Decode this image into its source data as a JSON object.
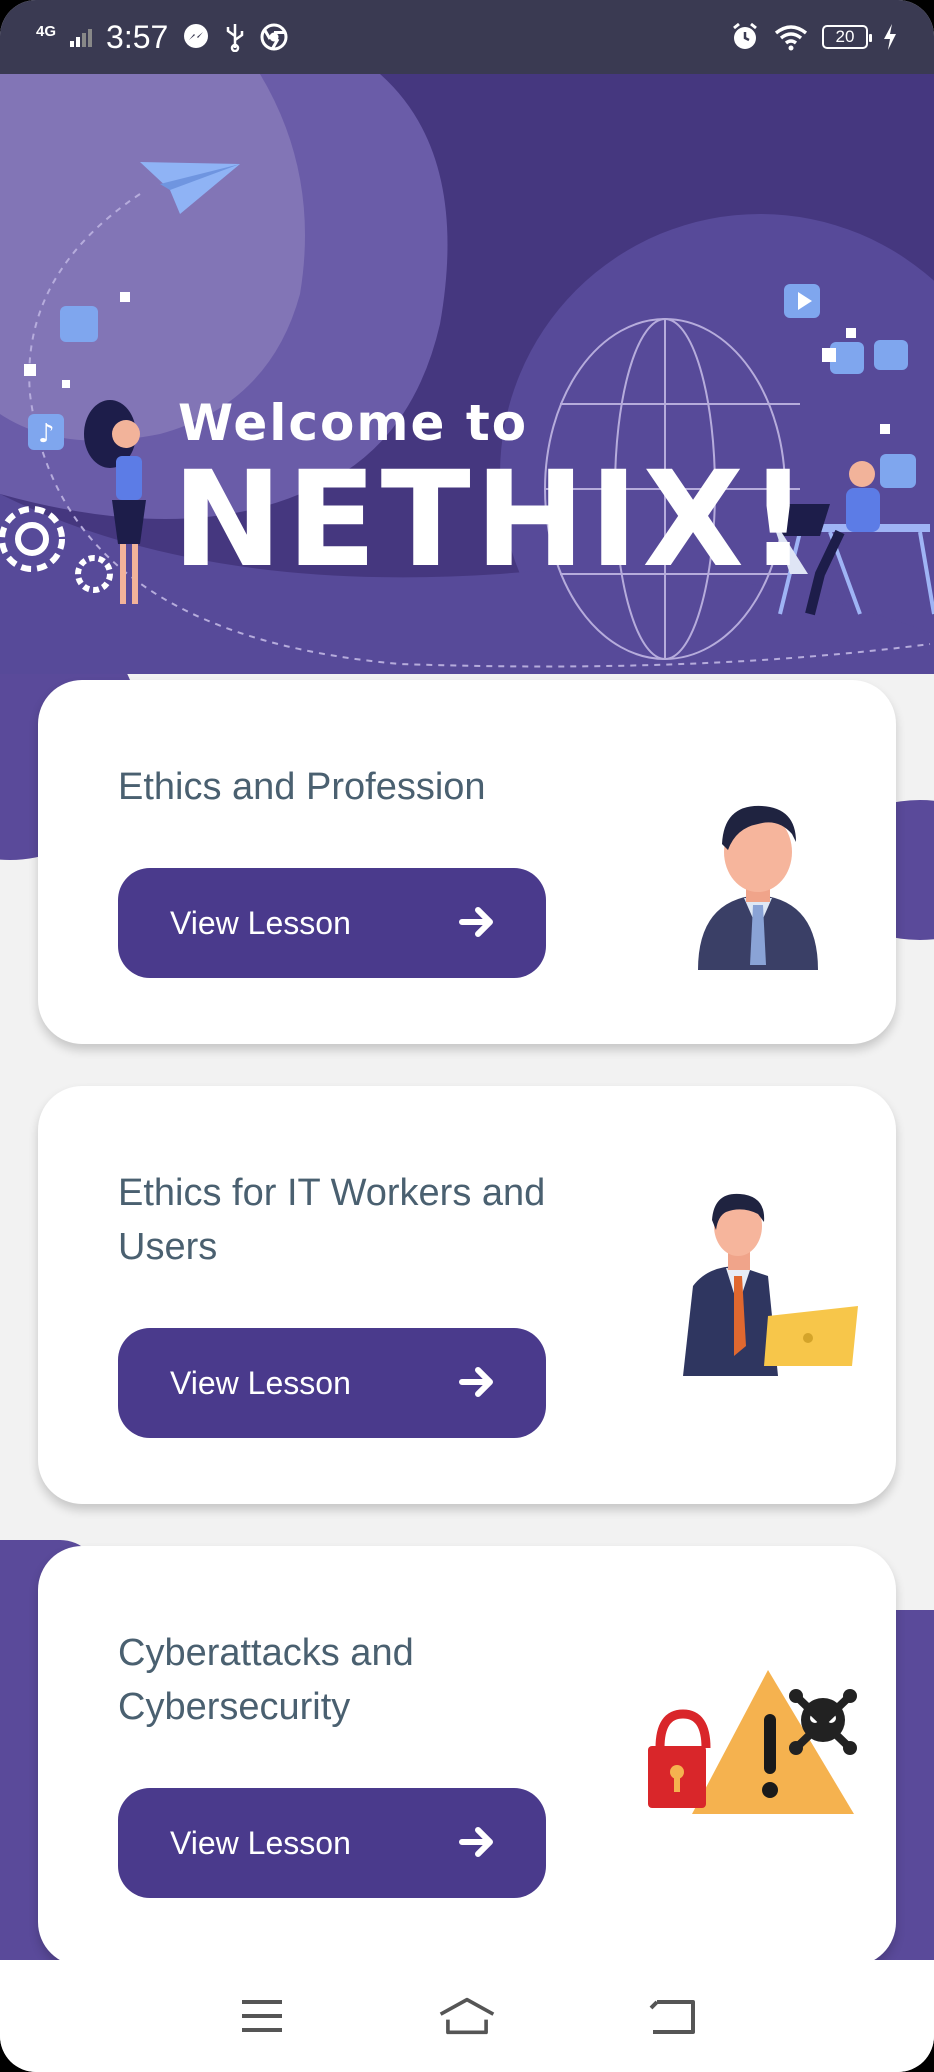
{
  "status_bar": {
    "network": "4G",
    "time": "3:57",
    "battery": "20"
  },
  "hero": {
    "welcome": "Welcome to",
    "app_name": "NETHIX!"
  },
  "lessons": [
    {
      "title": "Ethics and Profession",
      "button": "View Lesson"
    },
    {
      "title": "Ethics for IT Workers and Users",
      "button": "View Lesson"
    },
    {
      "title": "Cyberattacks and Cybersecurity",
      "button": "View Lesson"
    }
  ],
  "colors": {
    "primary": "#4a3a8c",
    "hero_bg": "#45377f",
    "accent": "#5a4a9a"
  },
  "icons": {
    "status": [
      "messenger-icon",
      "usb-icon",
      "chrome-icon",
      "alarm-icon",
      "wifi-icon",
      "charging-icon"
    ],
    "nav": [
      "menu-icon",
      "home-icon",
      "back-icon"
    ]
  }
}
